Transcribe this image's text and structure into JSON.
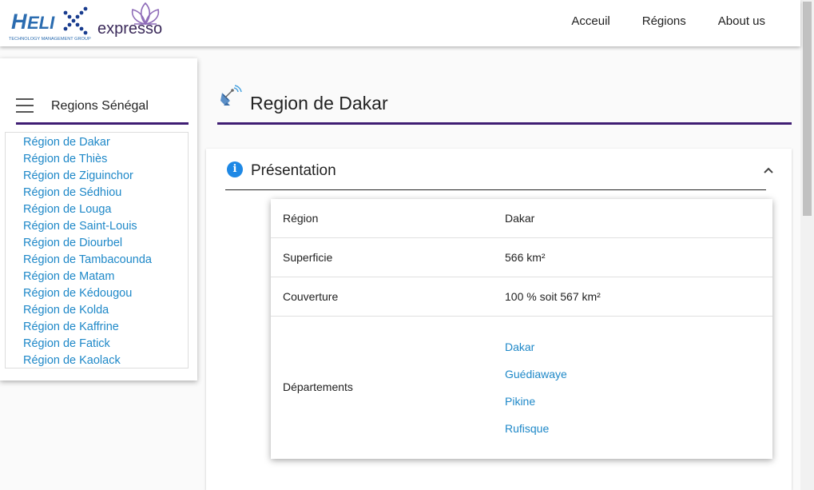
{
  "brand": {
    "logo_name": "HELIX expresso",
    "logo_subtitle": "TECHNOLOGY MANAGEMENT GROUP",
    "accent_color": "#3f1d73",
    "link_color": "#1e88c8"
  },
  "nav": {
    "items": [
      "Acceuil",
      "Régions",
      "About us"
    ]
  },
  "sidebar": {
    "title": "Regions Sénégal",
    "regions": [
      "Région de Dakar",
      "Région de Thiès",
      "Région de Ziguinchor",
      "Région de Sédhiou",
      "Région de Louga",
      "Région de Saint-Louis",
      "Région de Diourbel",
      "Région de Tambacounda",
      "Région de Matam",
      "Région de Kédougou",
      "Région de Kolda",
      "Région de Kaffrine",
      "Région de Fatick",
      "Région de Kaolack"
    ]
  },
  "page": {
    "title": "Region de Dakar"
  },
  "panel": {
    "title": "Présentation",
    "info_icon_glyph": "i",
    "rows": [
      {
        "label": "Région",
        "value": "Dakar"
      },
      {
        "label": "Superficie",
        "value": "566 km²"
      },
      {
        "label": "Couverture",
        "value": "100 % soit 567 km²"
      }
    ],
    "departements_label": "Départements",
    "departements": [
      "Dakar",
      "Guédiawaye",
      "Pikine",
      "Rufisque"
    ]
  }
}
